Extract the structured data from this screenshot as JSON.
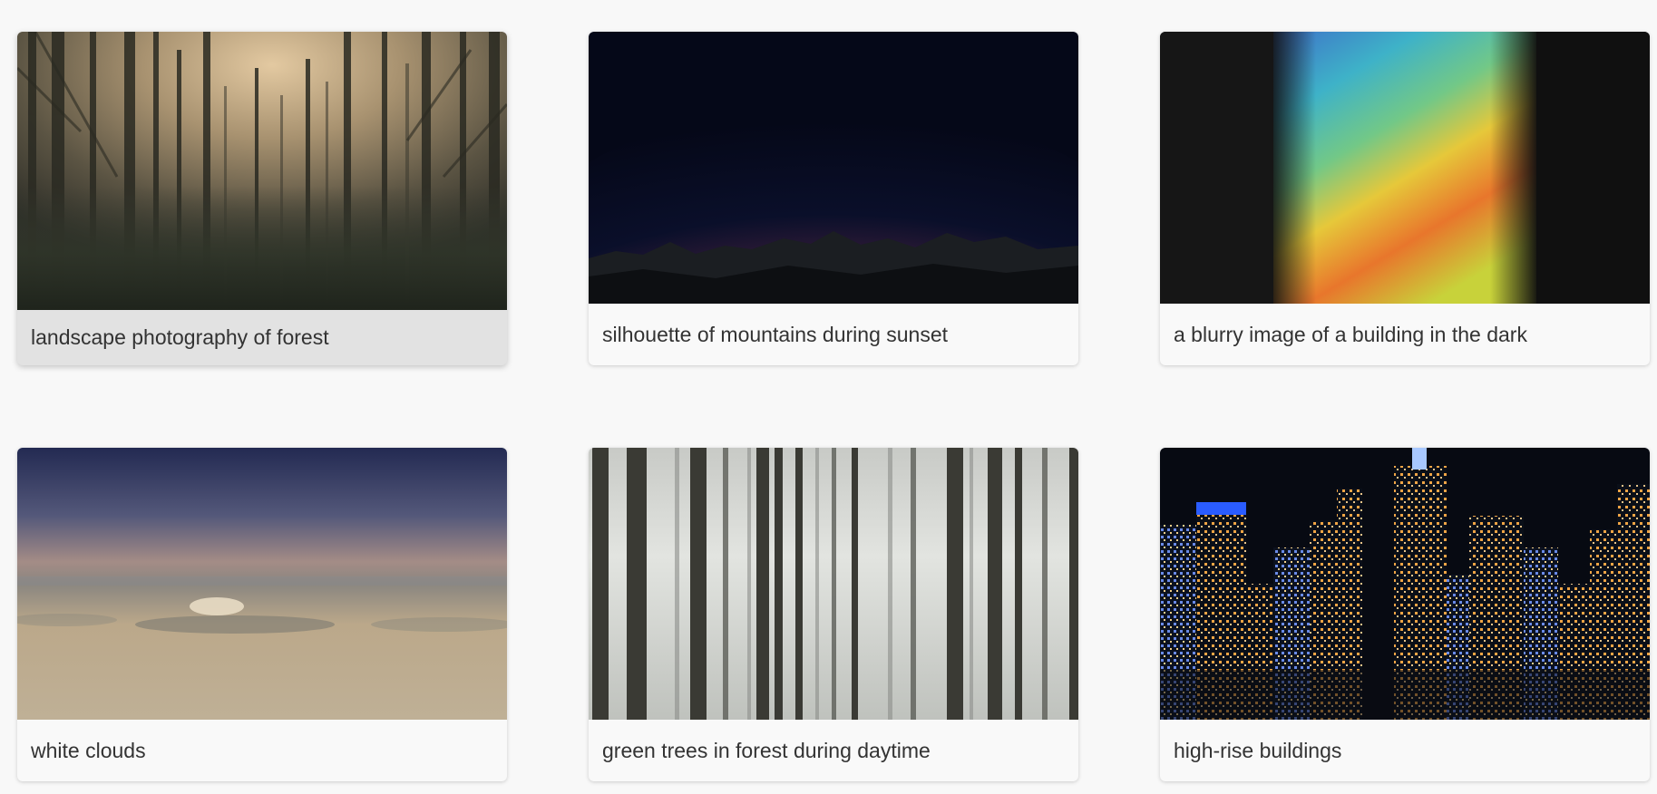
{
  "gallery": {
    "cards": [
      {
        "caption": "landscape photography of forest",
        "image_subject": "misty-forest-photo",
        "state": "hovered"
      },
      {
        "caption": "silhouette of mountains during sunset",
        "image_subject": "mountain-sunset-photo"
      },
      {
        "caption": "a blurry image of a building in the dark",
        "image_subject": "rainbow-light-blur-photo"
      },
      {
        "caption": "white clouds",
        "image_subject": "clouds-horizon-photo"
      },
      {
        "caption": "green trees in forest during daytime",
        "image_subject": "foggy-trees-photo"
      },
      {
        "caption": "high-rise buildings",
        "image_subject": "city-night-skyline-photo"
      }
    ]
  },
  "colors": {
    "page_background": "#f8f8f8",
    "card_background": "#f9f9f9",
    "card_hover_background": "#e2e2e2",
    "caption_text": "#333333"
  }
}
